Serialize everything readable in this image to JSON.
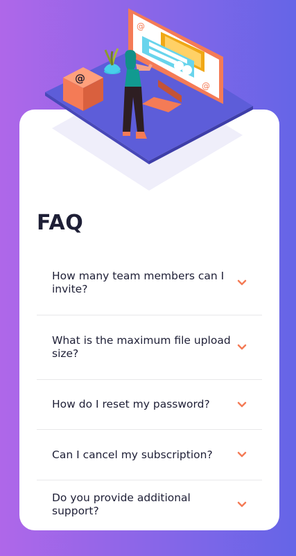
{
  "page": {
    "title": "FAQ"
  },
  "faq": {
    "items": [
      {
        "question": "How many team members can I invite?"
      },
      {
        "question": "What is the maximum file upload size?"
      },
      {
        "question": "How do I reset my password?"
      },
      {
        "question": "Can I cancel my subscription?"
      },
      {
        "question": "Do you provide additional support?"
      }
    ]
  },
  "colors": {
    "gradient_start": "#af67e9",
    "gradient_end": "#6565e7",
    "accent": "#f47b56",
    "title_text": "#1e1f36",
    "divider": "#e8e8ea"
  },
  "icons": {
    "expand": "chevron-down-icon"
  }
}
